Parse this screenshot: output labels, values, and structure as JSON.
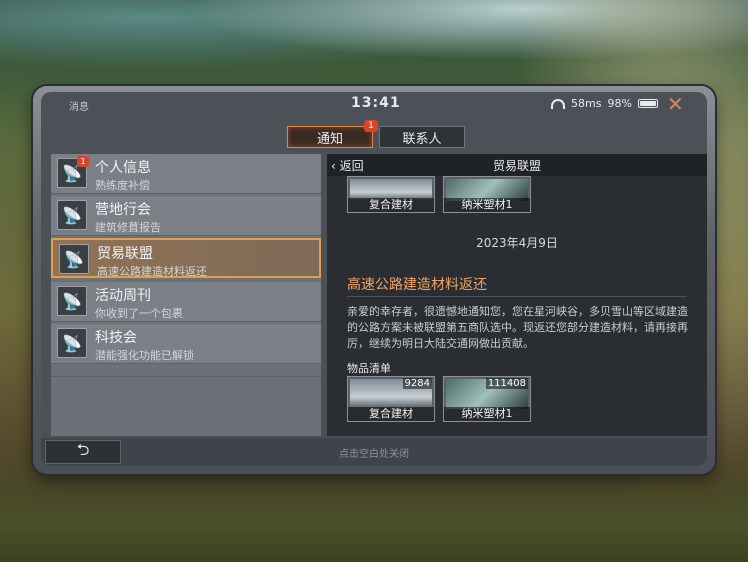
{
  "status": {
    "left_label": "消息",
    "time": "13:41",
    "network": "58ms",
    "battery": "98%"
  },
  "tabs": [
    {
      "label": "通知",
      "badge": "1",
      "active": true
    },
    {
      "label": "联系人",
      "badge": "",
      "active": false
    }
  ],
  "list": [
    {
      "title": "个人信息",
      "subtitle": "熟练度补偿",
      "badge": "1"
    },
    {
      "title": "营地行会",
      "subtitle": "建筑修葺报告",
      "badge": ""
    },
    {
      "title": "贸易联盟",
      "subtitle": "高速公路建造材料返还",
      "badge": ""
    },
    {
      "title": "活动周刊",
      "subtitle": "你收到了一个包裹",
      "badge": ""
    },
    {
      "title": "科技会",
      "subtitle": "潜能强化功能已解锁",
      "badge": ""
    }
  ],
  "detail": {
    "back_label": "返回",
    "title": "贸易联盟",
    "top_items": [
      {
        "name": "复合建材"
      },
      {
        "name": "纳米塑材1"
      }
    ],
    "date": "2023年4月9日",
    "mail_title": "高速公路建造材料返还",
    "body": "亲爱的幸存者，很遗憾地通知您，您在星河峡谷，多贝雪山等区域建造的公路方案未被联盟第五商队选中。现返还您部分建造材料，请再接再厉，继续为明日大陆交通网做出贡献。",
    "items_label": "物品清单",
    "items": [
      {
        "name": "复合建材",
        "qty": "9284"
      },
      {
        "name": "纳米塑材1",
        "qty": "111408"
      }
    ]
  },
  "bottom": {
    "return_icon": "return-arrow-icon",
    "hint": "点击空白处关闭"
  },
  "colors": {
    "accent": "#e0834a",
    "title_orange": "#f0a566",
    "badge_red": "#d5452f"
  }
}
